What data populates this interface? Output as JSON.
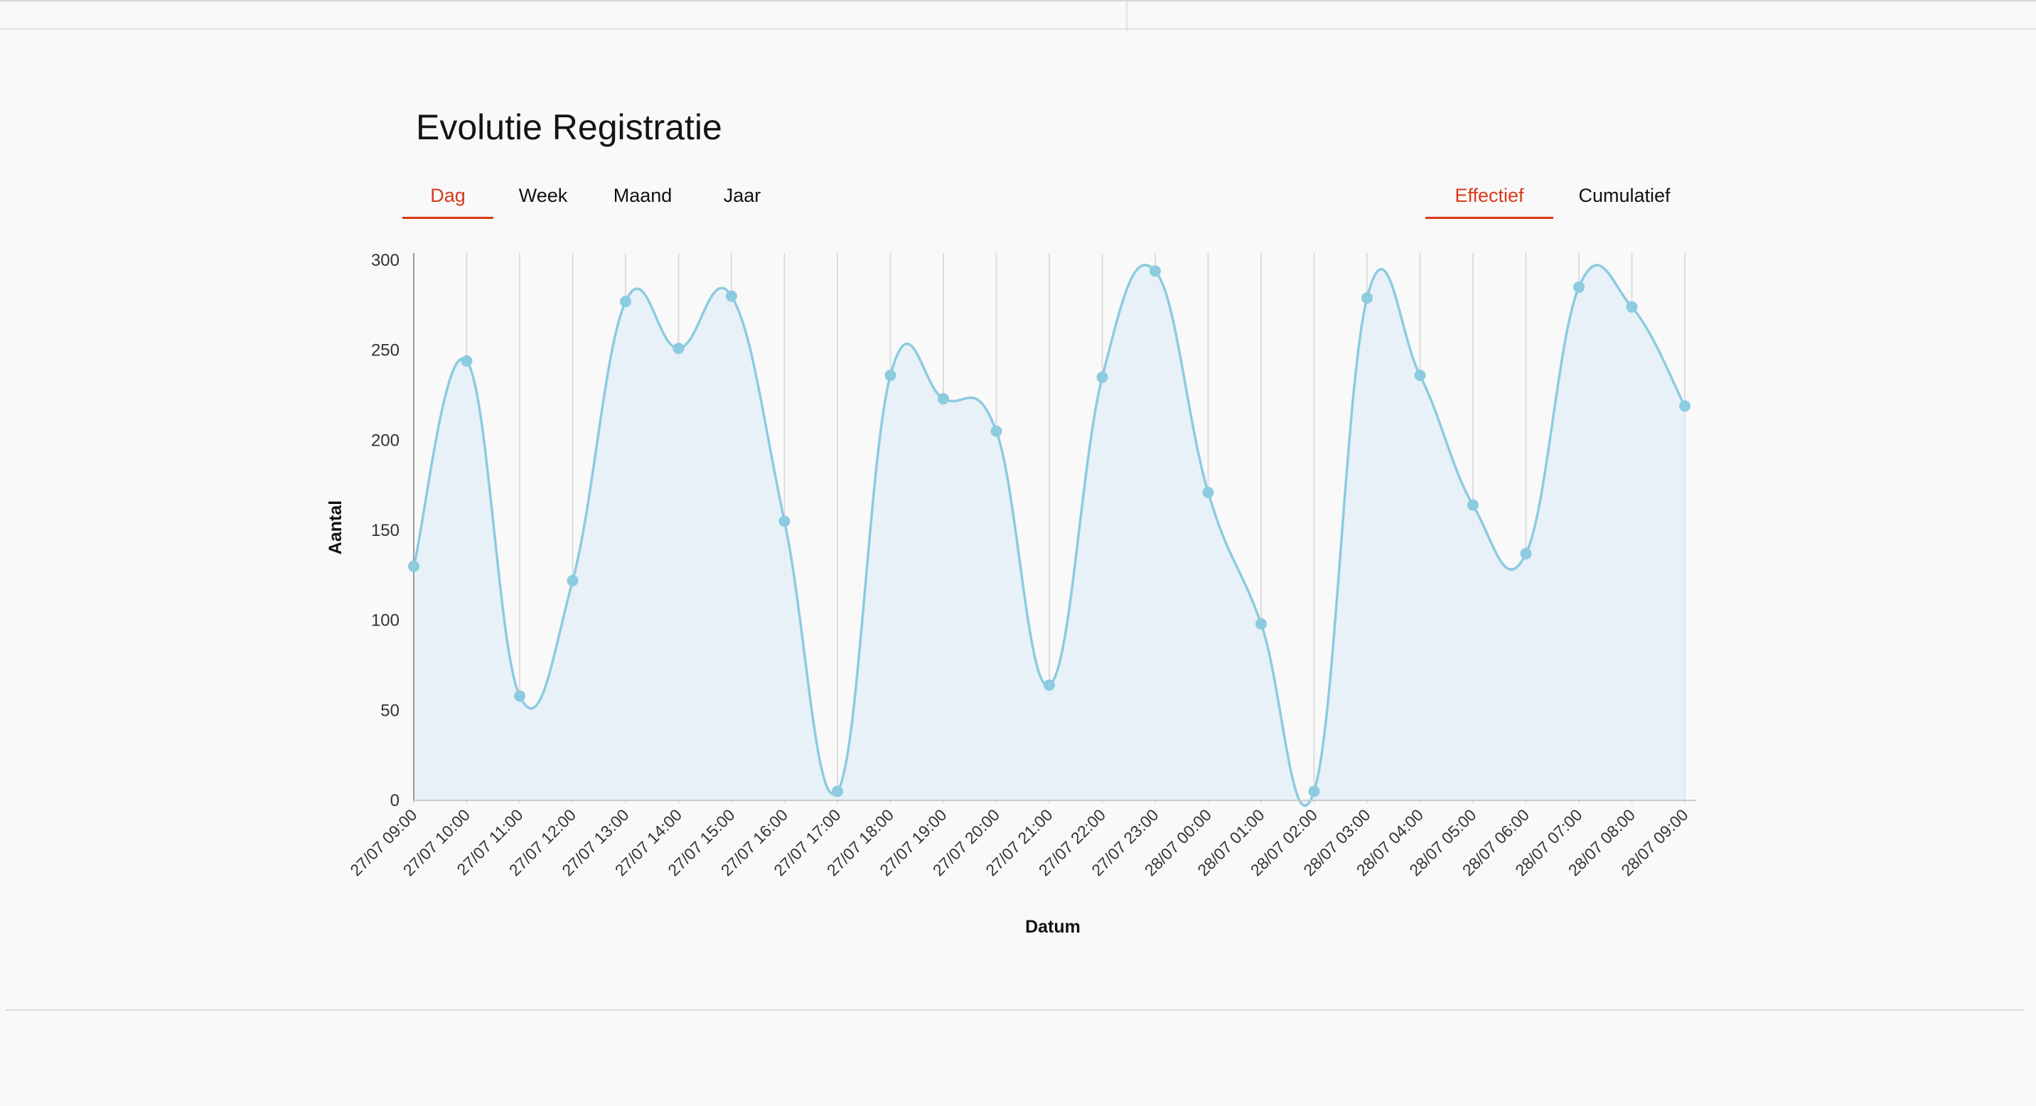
{
  "title": "Evolutie Registratie",
  "accent_color": "#d9391a",
  "line_color": "#8ccbe0",
  "fill_color": "#e4f0f6",
  "period_tabs": [
    {
      "label": "Dag",
      "active": true
    },
    {
      "label": "Week",
      "active": false
    },
    {
      "label": "Maand",
      "active": false
    },
    {
      "label": "Jaar",
      "active": false
    }
  ],
  "mode_tabs": [
    {
      "label": "Effectief",
      "active": true
    },
    {
      "label": "Cumulatief",
      "active": false
    }
  ],
  "chart_data": {
    "type": "area",
    "xlabel": "Datum",
    "ylabel": "Aantal",
    "ylim": [
      0,
      300
    ],
    "yticks": [
      0,
      50,
      100,
      150,
      200,
      250,
      300
    ],
    "grid": "vertical",
    "x": [
      "27/07 09:00",
      "27/07 10:00",
      "27/07 11:00",
      "27/07 12:00",
      "27/07 13:00",
      "27/07 14:00",
      "27/07 15:00",
      "27/07 16:00",
      "27/07 17:00",
      "27/07 18:00",
      "27/07 19:00",
      "27/07 20:00",
      "27/07 21:00",
      "27/07 22:00",
      "27/07 23:00",
      "28/07 00:00",
      "28/07 01:00",
      "28/07 02:00",
      "28/07 03:00",
      "28/07 04:00",
      "28/07 05:00",
      "28/07 06:00",
      "28/07 07:00",
      "28/07 08:00",
      "28/07 09:00"
    ],
    "values": [
      130,
      244,
      58,
      122,
      277,
      251,
      280,
      155,
      5,
      236,
      223,
      205,
      64,
      235,
      294,
      171,
      98,
      5,
      279,
      236,
      164,
      137,
      285,
      274,
      219
    ]
  }
}
